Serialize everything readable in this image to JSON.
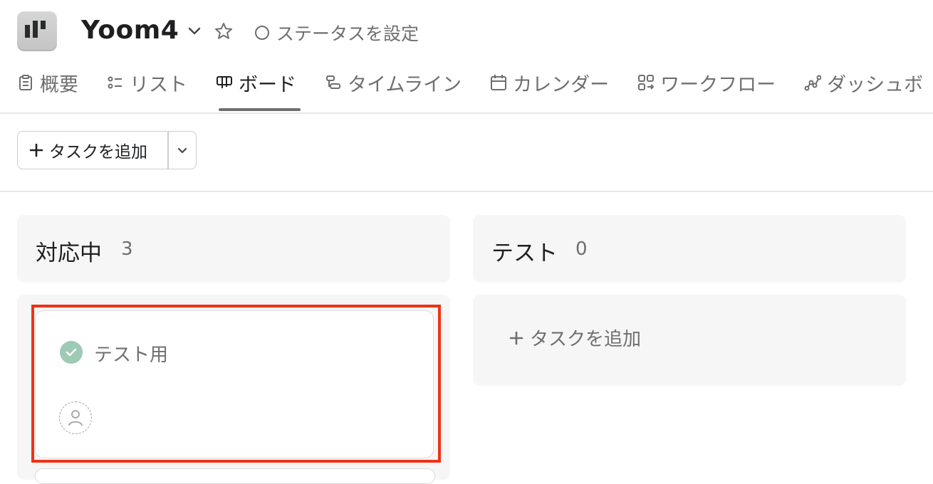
{
  "project": {
    "title": "Yoom4",
    "status_label": "ステータスを設定"
  },
  "tabs": [
    {
      "label": "概要",
      "icon": "clipboard-icon"
    },
    {
      "label": "リスト",
      "icon": "list-icon"
    },
    {
      "label": "ボード",
      "icon": "board-icon",
      "active": true
    },
    {
      "label": "タイムライン",
      "icon": "timeline-icon"
    },
    {
      "label": "カレンダー",
      "icon": "calendar-icon"
    },
    {
      "label": "ワークフロー",
      "icon": "workflow-icon"
    },
    {
      "label": "ダッシュボ",
      "icon": "dashboard-icon"
    }
  ],
  "toolbar": {
    "add_task_label": "タスクを追加"
  },
  "columns": [
    {
      "name": "対応中",
      "count": "3",
      "cards": [
        {
          "title": "テスト用",
          "completed": true
        }
      ]
    },
    {
      "name": "テスト",
      "count": "0",
      "add_task_label": "タスクを追加"
    }
  ],
  "colors": {
    "highlight": "#ee3216",
    "check": "#9ec9b4",
    "column_bg": "#f6f6f6"
  }
}
